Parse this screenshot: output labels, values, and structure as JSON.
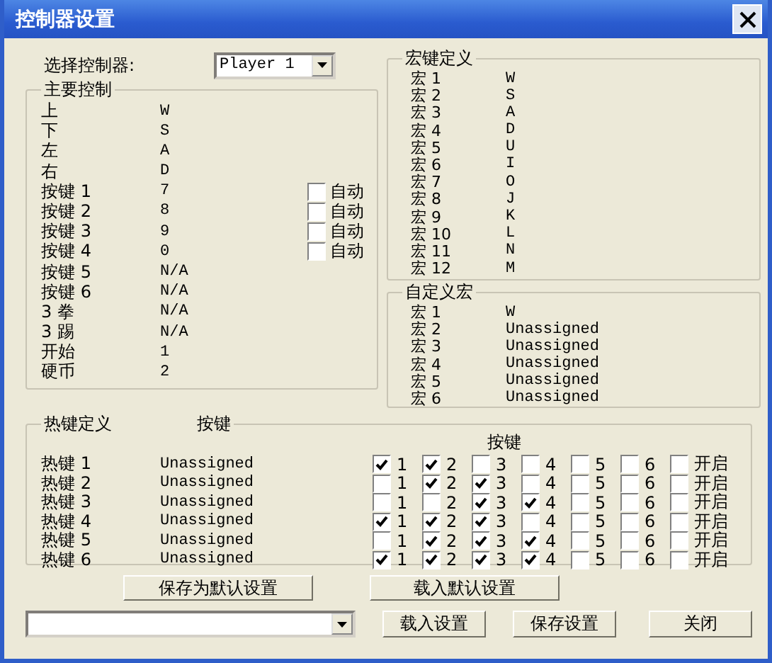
{
  "window": {
    "title": "控制器设置"
  },
  "controller_select": {
    "label": "选择控制器:",
    "value": "Player 1"
  },
  "main_controls": {
    "title": "主要控制",
    "rows": [
      {
        "kind": "plain",
        "label": "上",
        "value": "W"
      },
      {
        "kind": "plain",
        "label": "下",
        "value": "S"
      },
      {
        "kind": "plain",
        "label": "左",
        "value": "A"
      },
      {
        "kind": "plain",
        "label": "右",
        "value": "D"
      },
      {
        "kind": "auto",
        "label": "按键 1",
        "value": "7",
        "auto_label": "自动",
        "checked": false
      },
      {
        "kind": "auto",
        "label": "按键 2",
        "value": "8",
        "auto_label": "自动",
        "checked": false
      },
      {
        "kind": "auto",
        "label": "按键 3",
        "value": "9",
        "auto_label": "自动",
        "checked": false
      },
      {
        "kind": "auto",
        "label": "按键 4",
        "value": "0",
        "auto_label": "自动",
        "checked": false
      },
      {
        "kind": "plain",
        "label": "按键 5",
        "value": "N/A"
      },
      {
        "kind": "plain",
        "label": "按键 6",
        "value": "N/A"
      },
      {
        "kind": "plain",
        "label": "3 拳",
        "value": "N/A"
      },
      {
        "kind": "plain",
        "label": "3 踢",
        "value": "N/A"
      },
      {
        "kind": "plain",
        "label": "开始",
        "value": "1"
      },
      {
        "kind": "plain",
        "label": "硬币",
        "value": "2"
      }
    ]
  },
  "macro_keys": {
    "title": "宏键定义",
    "rows": [
      {
        "label": "宏 1",
        "value": "W"
      },
      {
        "label": "宏 2",
        "value": "S"
      },
      {
        "label": "宏 3",
        "value": "A"
      },
      {
        "label": "宏 4",
        "value": "D"
      },
      {
        "label": "宏 5",
        "value": "U"
      },
      {
        "label": "宏 6",
        "value": "I"
      },
      {
        "label": "宏 7",
        "value": "O"
      },
      {
        "label": "宏 8",
        "value": "J"
      },
      {
        "label": "宏 9",
        "value": "K"
      },
      {
        "label": "宏 10",
        "value": "L"
      },
      {
        "label": "宏 11",
        "value": "N"
      },
      {
        "label": "宏 12",
        "value": "M"
      }
    ]
  },
  "custom_macros": {
    "title": "自定义宏",
    "rows": [
      {
        "label": "宏 1",
        "value": "W"
      },
      {
        "label": "宏 2",
        "value": "Unassigned"
      },
      {
        "label": "宏 3",
        "value": "Unassigned"
      },
      {
        "label": "宏 4",
        "value": "Unassigned"
      },
      {
        "label": "宏 5",
        "value": "Unassigned"
      },
      {
        "label": "宏 6",
        "value": "Unassigned"
      }
    ]
  },
  "hotkeys": {
    "title": "热键定义",
    "key_header": "按键",
    "buttons_header": "按键",
    "rows": [
      {
        "label": "热键 1",
        "value": "Unassigned",
        "options": [
          {
            "label": "1",
            "checked": true
          },
          {
            "label": "2",
            "checked": true
          },
          {
            "label": "3",
            "checked": false
          },
          {
            "label": "4",
            "checked": false
          },
          {
            "label": "5",
            "checked": false
          },
          {
            "label": "6",
            "checked": false
          },
          {
            "label": "开启",
            "checked": false
          }
        ]
      },
      {
        "label": "热键 2",
        "value": "Unassigned",
        "options": [
          {
            "label": "1",
            "checked": false
          },
          {
            "label": "2",
            "checked": true
          },
          {
            "label": "3",
            "checked": true
          },
          {
            "label": "4",
            "checked": false
          },
          {
            "label": "5",
            "checked": false
          },
          {
            "label": "6",
            "checked": false
          },
          {
            "label": "开启",
            "checked": false
          }
        ]
      },
      {
        "label": "热键 3",
        "value": "Unassigned",
        "options": [
          {
            "label": "1",
            "checked": false
          },
          {
            "label": "2",
            "checked": false
          },
          {
            "label": "3",
            "checked": true
          },
          {
            "label": "4",
            "checked": true
          },
          {
            "label": "5",
            "checked": false
          },
          {
            "label": "6",
            "checked": false
          },
          {
            "label": "开启",
            "checked": false
          }
        ]
      },
      {
        "label": "热键 4",
        "value": "Unassigned",
        "options": [
          {
            "label": "1",
            "checked": true
          },
          {
            "label": "2",
            "checked": true
          },
          {
            "label": "3",
            "checked": true
          },
          {
            "label": "4",
            "checked": false
          },
          {
            "label": "5",
            "checked": false
          },
          {
            "label": "6",
            "checked": false
          },
          {
            "label": "开启",
            "checked": false
          }
        ]
      },
      {
        "label": "热键 5",
        "value": "Unassigned",
        "options": [
          {
            "label": "1",
            "checked": false
          },
          {
            "label": "2",
            "checked": true
          },
          {
            "label": "3",
            "checked": true
          },
          {
            "label": "4",
            "checked": true
          },
          {
            "label": "5",
            "checked": false
          },
          {
            "label": "6",
            "checked": false
          },
          {
            "label": "开启",
            "checked": false
          }
        ]
      },
      {
        "label": "热键 6",
        "value": "Unassigned",
        "options": [
          {
            "label": "1",
            "checked": true
          },
          {
            "label": "2",
            "checked": true
          },
          {
            "label": "3",
            "checked": true
          },
          {
            "label": "4",
            "checked": true
          },
          {
            "label": "5",
            "checked": false
          },
          {
            "label": "6",
            "checked": false
          },
          {
            "label": "开启",
            "checked": false
          }
        ]
      }
    ]
  },
  "default_buttons": [
    "保存为默认设置",
    "载入默认设置"
  ],
  "bottom_buttons": [
    "载入设置",
    "保存设置",
    "关闭"
  ]
}
